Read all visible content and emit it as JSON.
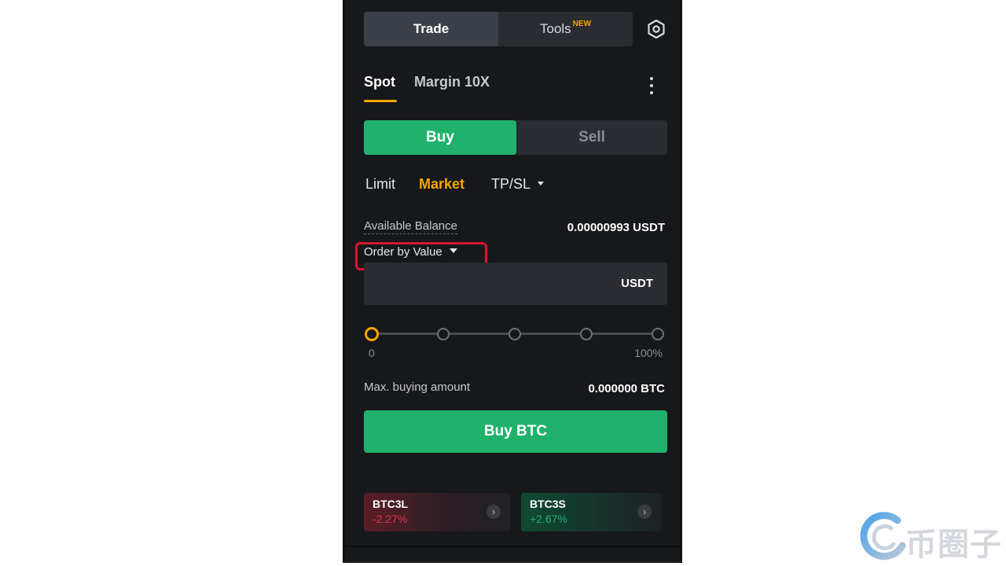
{
  "top_tabs": {
    "trade": "Trade",
    "tools": "Tools",
    "tools_badge": "NEW"
  },
  "market_tabs": {
    "spot": "Spot",
    "margin": "Margin 10X"
  },
  "side": {
    "buy": "Buy",
    "sell": "Sell"
  },
  "order_types": {
    "limit": "Limit",
    "market": "Market",
    "tpsl": "TP/SL"
  },
  "balance": {
    "label": "Available Balance",
    "value": "0.00000993 USDT"
  },
  "order_by": {
    "label": "Order by Value"
  },
  "value_input": {
    "unit": "USDT",
    "value": ""
  },
  "slider": {
    "min_label": "0",
    "max_label": "100%",
    "value_percent": 0,
    "stops_percent": [
      0,
      25,
      50,
      75,
      100
    ]
  },
  "max_buying": {
    "label": "Max. buying amount",
    "value": "0.000000 BTC"
  },
  "buy_button": "Buy BTC",
  "cards": [
    {
      "name": "BTC3L",
      "change": "-2.27%",
      "color": "#e0334a"
    },
    {
      "name": "BTC3S",
      "change": "+2.67%",
      "color": "#20b26c"
    }
  ],
  "watermark": {
    "text": "币圈子"
  },
  "colors": {
    "accent": "#f7a600",
    "buy": "#20b26c",
    "sell_red": "#e0334a",
    "highlight_box": "#d6172c",
    "panel_bg": "#17181b"
  },
  "icons": {
    "settings": "settings-hex-icon",
    "more": "more-vertical-icon",
    "caret": "caret-down-icon",
    "chevron": "chevron-right-icon"
  }
}
